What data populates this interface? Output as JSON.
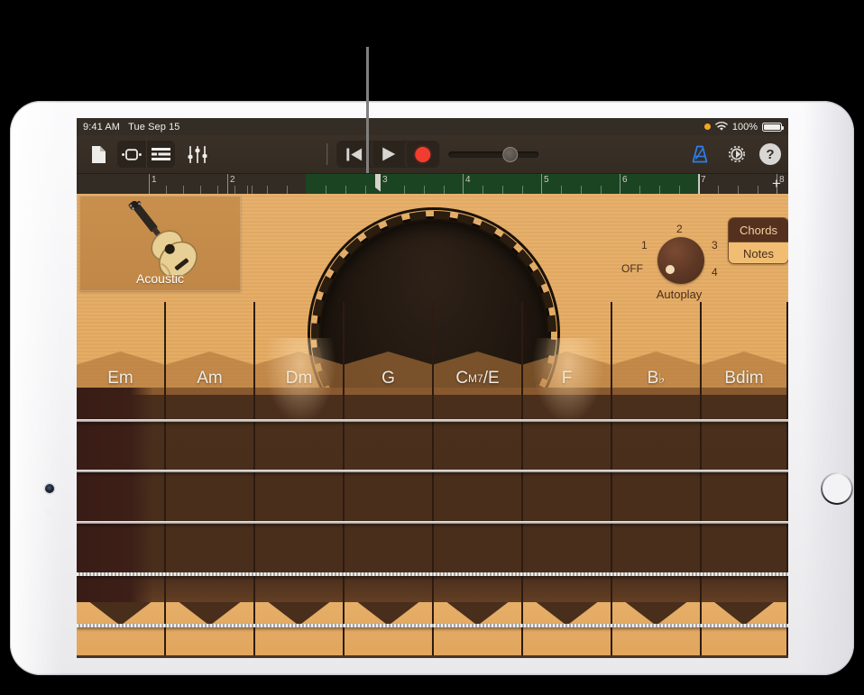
{
  "status_bar": {
    "time": "9:41 AM",
    "date": "Tue Sep 15",
    "battery_percent": "100%",
    "icons": [
      "orange-recording-dot",
      "wifi-icon",
      "battery-icon"
    ]
  },
  "toolbar": {
    "left_buttons": [
      {
        "name": "document-icon",
        "label": ""
      },
      {
        "name": "cycle-icon",
        "label": ""
      },
      {
        "name": "track-list-icon",
        "label": ""
      },
      {
        "name": "mixer-faders-icon",
        "label": ""
      }
    ],
    "transport": [
      {
        "name": "rewind-to-start-button",
        "label": ""
      },
      {
        "name": "play-button",
        "label": ""
      },
      {
        "name": "record-button",
        "label": ""
      }
    ],
    "volume_value": 60,
    "right_buttons": [
      {
        "name": "metronome-icon",
        "label": ""
      },
      {
        "name": "settings-gear-icon",
        "label": ""
      },
      {
        "name": "help-button",
        "label": "?"
      }
    ]
  },
  "ruler": {
    "bars": [
      "1",
      "2",
      "3",
      "4",
      "5",
      "6",
      "7",
      "8"
    ],
    "playhead_bar": "3",
    "add_track_label": "+",
    "cycle_region_start_bar": 3,
    "cycle_region_end_bar": 8
  },
  "instrument": {
    "card_label": "Acoustic",
    "autoplay": {
      "title": "Autoplay",
      "off_label": "OFF",
      "positions": [
        "1",
        "2",
        "3",
        "4"
      ],
      "selected": "OFF"
    },
    "mode_switch": {
      "chords_label": "Chords",
      "notes_label": "Notes",
      "selected": "Chords"
    },
    "chords": [
      {
        "root": "Em",
        "sup": "",
        "bass": ""
      },
      {
        "root": "Am",
        "sup": "",
        "bass": ""
      },
      {
        "root": "Dm",
        "sup": "",
        "bass": ""
      },
      {
        "root": "G",
        "sup": "",
        "bass": ""
      },
      {
        "root": "C",
        "sup": "M7",
        "bass": "/E"
      },
      {
        "root": "F",
        "sup": "",
        "bass": ""
      },
      {
        "root": "B",
        "sup": "",
        "flat": "♭",
        "bass": ""
      },
      {
        "root": "Bdim",
        "sup": "",
        "bass": ""
      }
    ],
    "string_count": 6
  },
  "colors": {
    "wood": "#e3a95f",
    "fretboard": "#4a2f1d",
    "record_red": "#f23d2e",
    "ruler_green": "#1b4423",
    "accent_blue": "#2d7ff0",
    "knob_brown": "#5c3724"
  }
}
